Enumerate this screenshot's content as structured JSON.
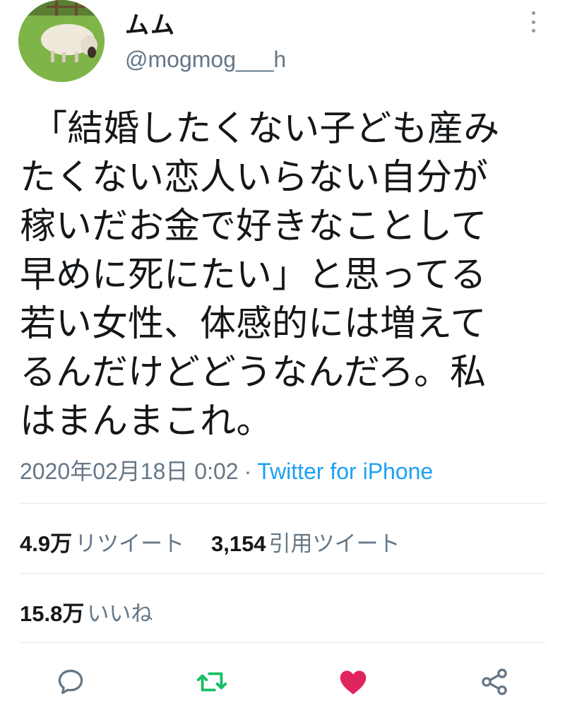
{
  "user": {
    "display_name": "ムム",
    "handle": "@mogmog___h",
    "avatar_icon": "sheep-avatar"
  },
  "tweet": {
    "text": " 「結婚したくない子ども産み\nたくない恋人いらない自分が\n稼いだお金で好きなことして\n早めに死にたい」と思ってる\n若い女性、体感的には増えて\nるんだけどどうなんだろ。私\nはまんまこれ。"
  },
  "meta": {
    "timestamp": "2020年02月18日 0:02",
    "separator": "·",
    "source": "Twitter for iPhone"
  },
  "stats": {
    "retweets": {
      "count": "4.9万",
      "label": "リツイート"
    },
    "quotes": {
      "count": "3,154",
      "label": "引用ツイート"
    },
    "likes": {
      "count": "15.8万",
      "label": "いいね"
    }
  },
  "actions": {
    "reply_icon": "comment-icon",
    "retweet_icon": "retweet-icon",
    "like_icon": "heart-icon",
    "share_icon": "share-icon"
  },
  "colors": {
    "accent": "#1da1f2",
    "retweet": "#17bf63",
    "like": "#e0245e",
    "secondary_text": "#657786"
  }
}
